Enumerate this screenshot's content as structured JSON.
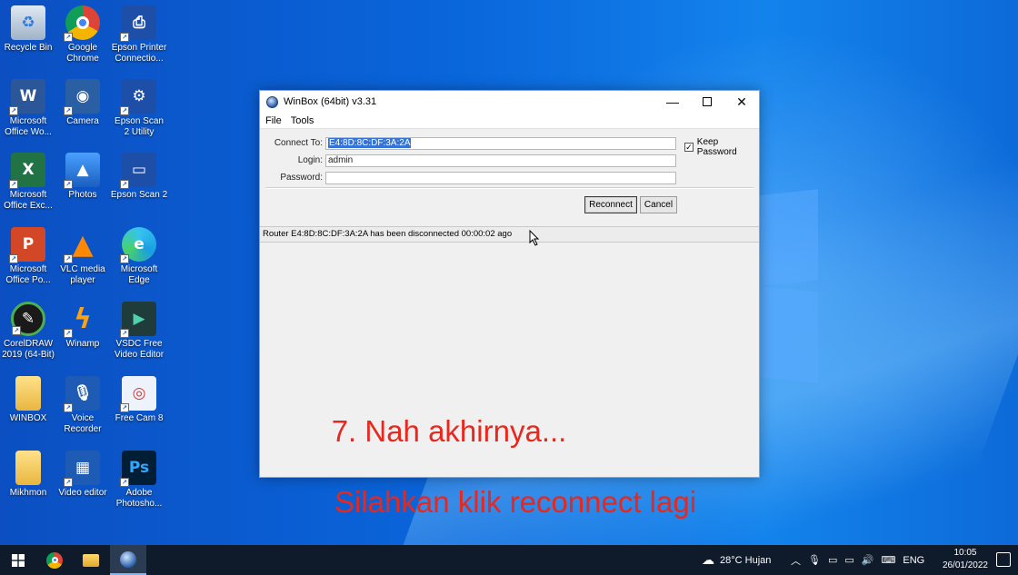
{
  "desktop": {
    "icons": [
      {
        "label": "Recycle Bin",
        "icon": "recycle-bin-icon"
      },
      {
        "label": "Google Chrome",
        "icon": "chrome-icon"
      },
      {
        "label": "Epson Printer Connectio...",
        "icon": "epson-printer-icon"
      },
      {
        "label": "Microsoft Office Wo...",
        "icon": "word-icon"
      },
      {
        "label": "Camera",
        "icon": "camera-icon"
      },
      {
        "label": "Epson Scan 2 Utility",
        "icon": "epson-scan-utility-icon"
      },
      {
        "label": "Microsoft Office Exc...",
        "icon": "excel-icon"
      },
      {
        "label": "Photos",
        "icon": "photos-icon"
      },
      {
        "label": "Epson Scan 2",
        "icon": "epson-scan-icon"
      },
      {
        "label": "Microsoft Office Po...",
        "icon": "powerpoint-icon"
      },
      {
        "label": "VLC media player",
        "icon": "vlc-icon"
      },
      {
        "label": "Microsoft Edge",
        "icon": "edge-icon"
      },
      {
        "label": "CorelDRAW 2019 (64-Bit)",
        "icon": "coreldraw-icon"
      },
      {
        "label": "Winamp",
        "icon": "winamp-icon"
      },
      {
        "label": "VSDC Free Video Editor",
        "icon": "vsdc-icon"
      },
      {
        "label": "WINBOX",
        "icon": "folder-icon"
      },
      {
        "label": "Voice Recorder",
        "icon": "voice-recorder-icon"
      },
      {
        "label": "Free Cam 8",
        "icon": "free-cam-icon"
      },
      {
        "label": "Mikhmon",
        "icon": "folder-icon"
      },
      {
        "label": "Video editor",
        "icon": "video-editor-icon"
      },
      {
        "label": "Adobe Photosho...",
        "icon": "photoshop-icon"
      }
    ]
  },
  "window": {
    "title": "WinBox (64bit) v3.31",
    "menu": [
      "File",
      "Tools"
    ],
    "form": {
      "connect_to_label": "Connect To:",
      "connect_to_value": "E4:8D:8C:DF:3A:2A",
      "login_label": "Login:",
      "login_value": "admin",
      "password_label": "Password:",
      "password_value": "",
      "keep_password_label": "Keep Password",
      "keep_password_checked": true
    },
    "buttons": {
      "reconnect": "Reconnect",
      "cancel": "Cancel"
    },
    "status": "Router E4:8D:8C:DF:3A:2A has been disconnected 00:00:02 ago",
    "annotation_line1": "7. Nah akhirnya...",
    "annotation_line2": "Silahkan klik reconnect lagi"
  },
  "taskbar": {
    "weather": "28°C  Hujan",
    "language": "ENG",
    "time": "10:05",
    "date": "26/01/2022"
  },
  "colors": {
    "annotation": "#e8271d",
    "selection": "#3573d4"
  }
}
